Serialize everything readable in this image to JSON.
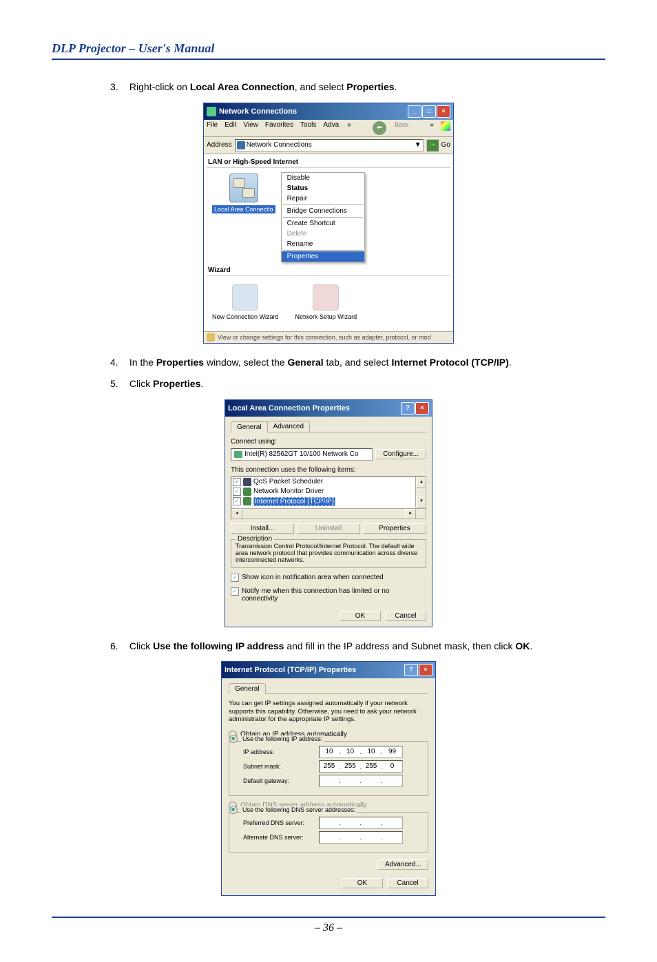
{
  "header": {
    "title": "DLP Projector – User's Manual"
  },
  "steps": {
    "s3": {
      "num": "3.",
      "prefix": "Right-click on ",
      "bold1": "Local Area Connection",
      "mid": ", and select ",
      "bold2": "Properties",
      "suffix": "."
    },
    "s4": {
      "num": "4.",
      "prefix": "In the ",
      "bold1": "Properties",
      "mid1": " window, select the ",
      "bold2": "General",
      "mid2": " tab, and select ",
      "bold3": "Internet Protocol (TCP/IP)",
      "suffix": "."
    },
    "s5": {
      "num": "5.",
      "prefix": "Click ",
      "bold1": "Properties",
      "suffix": "."
    },
    "s6": {
      "num": "6.",
      "prefix": "Click ",
      "bold1": "Use the following IP address",
      "mid": " and fill in the IP address and Subnet mask, then click ",
      "bold2": "OK",
      "suffix": "."
    }
  },
  "nc": {
    "title": "Network Connections",
    "menu": {
      "file": "File",
      "edit": "Edit",
      "view": "View",
      "favorites": "Favorites",
      "tools": "Tools",
      "adva": "Adva",
      "back": "Back"
    },
    "address_label": "Address",
    "address_value": "Network Connections",
    "go": "Go",
    "section1": "LAN or High-Speed Internet",
    "lac_label": "Local Area Connectio",
    "section2": "Wizard",
    "context": {
      "disable": "Disable",
      "status": "Status",
      "repair": "Repair",
      "bridge": "Bridge Connections",
      "shortcut": "Create Shortcut",
      "delete": "Delete",
      "rename": "Rename",
      "properties": "Properties"
    },
    "wiz1": "New Connection Wizard",
    "wiz2": "Network Setup Wizard",
    "status": "View or change settings for this connection, such as adapter, protocol, or mod"
  },
  "lac": {
    "title": "Local Area Connection Properties",
    "tabs": {
      "general": "General",
      "advanced": "Advanced"
    },
    "connect_using": "Connect using:",
    "adapter": "Intel(R) 82562GT 10/100 Network Co",
    "configure": "Configure...",
    "items_label": "This connection uses the following items:",
    "items": {
      "qos": "QoS Packet Scheduler",
      "nmd": "Network Monitor Driver",
      "tcpip": "Internet Protocol (TCP/IP)"
    },
    "buttons": {
      "install": "Install...",
      "uninstall": "Uninstall",
      "properties": "Properties"
    },
    "desc_label": "Description",
    "desc_text": "Transmission Control Protocol/Internet Protocol. The default wide area network protocol that provides communication across diverse interconnected networks.",
    "show_icon": "Show icon in notification area when connected",
    "notify": "Notify me when this connection has limited or no connectivity",
    "ok": "OK",
    "cancel": "Cancel"
  },
  "tcp": {
    "title": "Internet Protocol (TCP/IP) Properties",
    "tab_general": "General",
    "desc": "You can get IP settings assigned automatically if your network supports this capability. Otherwise, you need to ask your network administrator for the appropriate IP settings.",
    "obtain_ip": "Obtain an IP address automatically",
    "use_ip": "Use the following IP address:",
    "ip_label": "IP address:",
    "ip_value": [
      "10",
      "10",
      "10",
      "99"
    ],
    "mask_label": "Subnet mask:",
    "mask_value": [
      "255",
      "255",
      "255",
      "0"
    ],
    "gateway_label": "Default gateway:",
    "obtain_dns": "Obtain DNS server address automatically",
    "use_dns": "Use the following DNS server addresses:",
    "pref_dns": "Preferred DNS server:",
    "alt_dns": "Alternate DNS server:",
    "advanced": "Advanced...",
    "ok": "OK",
    "cancel": "Cancel"
  },
  "footer": {
    "page": "– 36 –"
  }
}
